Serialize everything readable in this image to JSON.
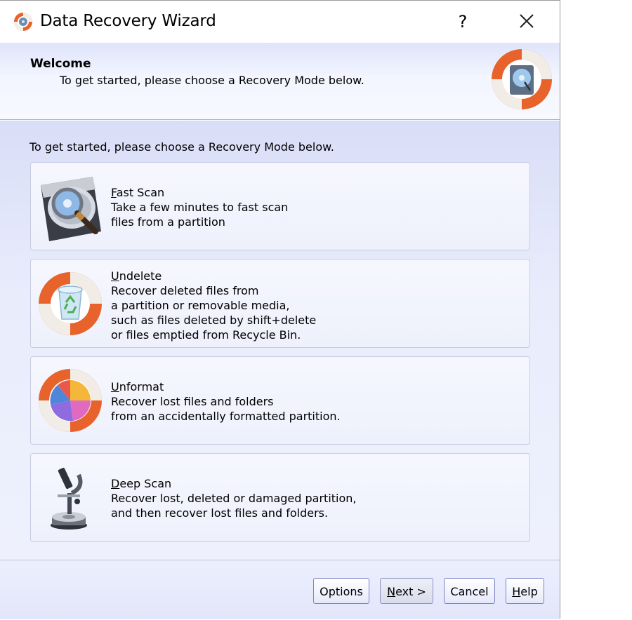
{
  "window": {
    "title": "Data Recovery Wizard",
    "help_glyph": "?",
    "app_icon": "lifebuoy-disk-icon"
  },
  "header": {
    "title": "Welcome",
    "subtitle": "To get started, please choose a Recovery Mode below.",
    "logo_icon": "lifebuoy-harddisk-logo"
  },
  "body": {
    "intro": "To get started, please choose a Recovery Mode below."
  },
  "modes": [
    {
      "title_first": "F",
      "title_rest": "ast Scan",
      "icon": "harddisk-magnifier-icon",
      "lines": [
        "Take a few minutes to fast scan",
        "files from a partition"
      ]
    },
    {
      "title_first": "U",
      "title_rest": "ndelete",
      "icon": "lifebuoy-recycle-bin-icon",
      "lines": [
        "Recover deleted files from",
        "a partition or removable media,",
        "such as files deleted by shift+delete",
        "or files emptied from Recycle Bin."
      ]
    },
    {
      "title_first": "U",
      "title_rest": "nformat",
      "icon": "lifebuoy-pie-chart-icon",
      "lines": [
        "Recover lost files and folders",
        "from an accidentally formatted partition."
      ]
    },
    {
      "title_first": "D",
      "title_rest": "eep Scan",
      "icon": "microscope-harddisk-icon",
      "lines": [
        "Recover lost, deleted or damaged partition,",
        "and then recover lost files and folders."
      ]
    }
  ],
  "footer": {
    "options": "Options",
    "next_first": "N",
    "next_rest": "ext >",
    "cancel": "Cancel",
    "help_first": "H",
    "help_rest": "elp"
  },
  "colors": {
    "accent_orange": "#e8632b",
    "band_blue": "#dfe4fb",
    "button_border": "#7b82c8"
  }
}
